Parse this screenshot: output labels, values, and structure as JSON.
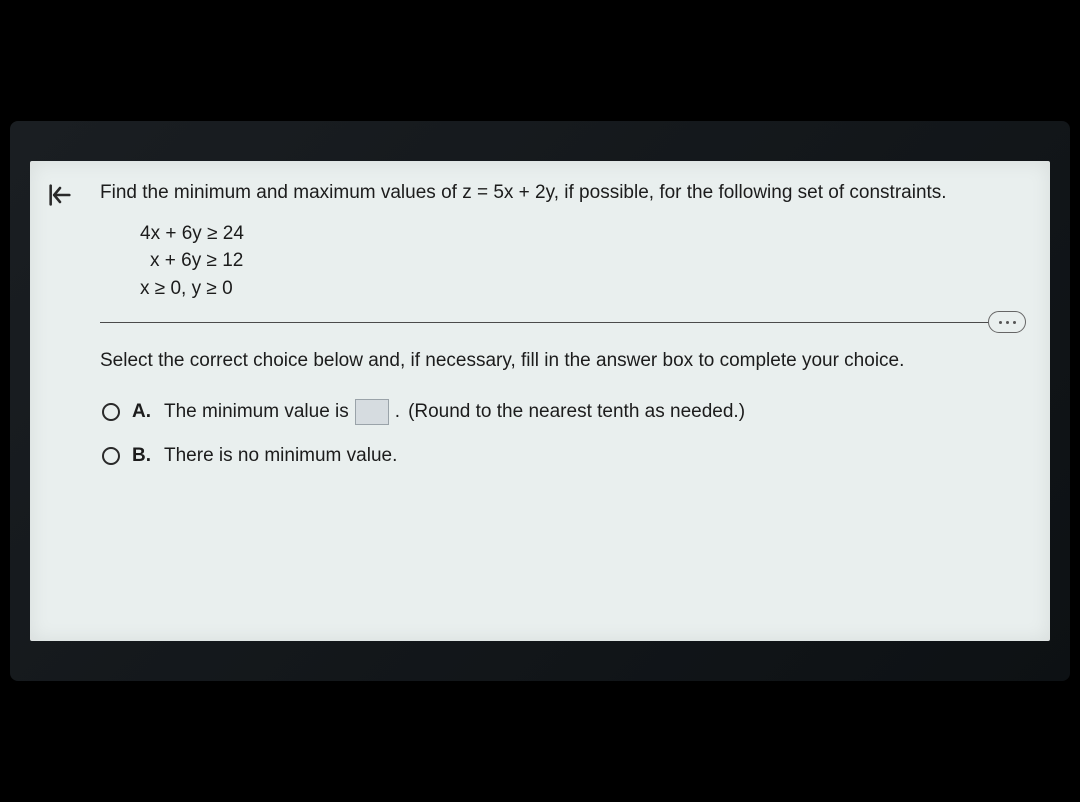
{
  "problem": {
    "statement": "Find the minimum and maximum values of z = 5x + 2y, if possible, for the following set of constraints.",
    "constraints": [
      "4x + 6y ≥ 24",
      "x + 6y ≥ 12",
      "x ≥ 0, y ≥ 0"
    ]
  },
  "instruction": "Select the correct choice below and, if necessary, fill in the answer box to complete your choice.",
  "choices": {
    "a": {
      "letter": "A.",
      "text_before": "The minimum value is",
      "text_after": ".",
      "hint": "(Round to the nearest tenth as needed.)"
    },
    "b": {
      "letter": "B.",
      "text": "There is no minimum value."
    }
  }
}
